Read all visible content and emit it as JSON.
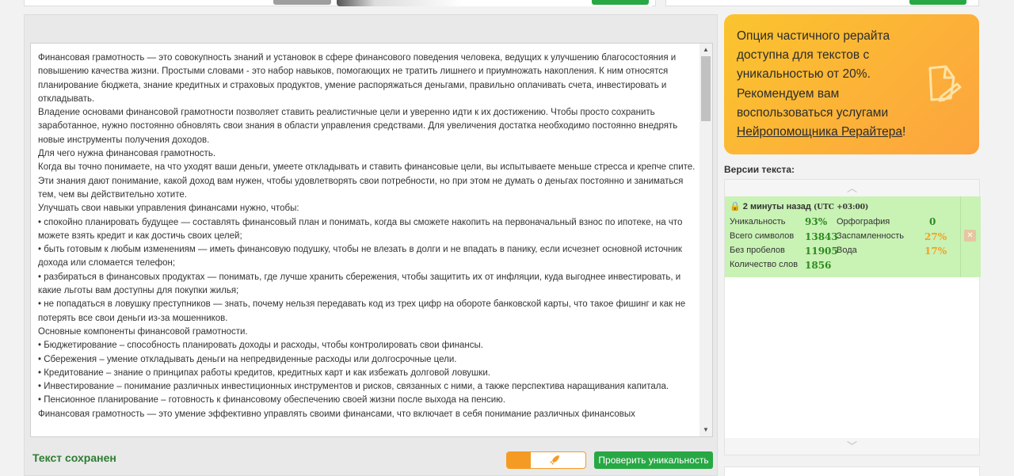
{
  "editor": {
    "paragraphs": [
      "Финансовая грамотность — это совокупность знаний и установок в сфере финансового поведения человека, ведущих к улучшению благосостояния и повышению качества жизни. Простыми словами - это набор навыков, помогающих не тратить лишнего и приумножать накопления. К ним относятся планирование бюджета, знание кредитных и страховых продуктов, умение распоряжаться деньгами, правильно оплачивать счета, инвестировать и откладывать.",
      "Владение основами финансовой грамотности позволяет ставить реалистичные цели и уверенно идти к их достижению. Чтобы просто сохранить заработанное, нужно постоянно обновлять свои знания в области управления средствами. Для увеличения достатка необходимо постоянно внедрять новые инструменты получения доходов.",
      "Для чего нужна финансовая грамотность.",
      "Когда вы точно понимаете, на что уходят ваши деньги, умеете откладывать и ставить финансовые цели, вы испытываете меньше стресса и крепче спите. Эти знания дают понимание, какой доход вам нужен, чтобы удовлетворять свои потребности, но при этом не думать о деньгах постоянно и заниматься тем, чем вы действительно хотите.",
      "Улучшать свои навыки управления финансами нужно, чтобы:",
      "• спокойно планировать будущее — составлять финансовый план и понимать, когда вы сможете накопить на первоначальный взнос по ипотеке, на что можете взять кредит и как достичь своих целей;",
      "• быть готовым к любым изменениям — иметь финансовую подушку, чтобы не влезать в долги и не впадать в панику, если исчезнет основной источник дохода или сломается телефон;",
      "• разбираться в финансовых продуктах — понимать, где лучше хранить сбережения, чтобы защитить их от инфляции, куда выгоднее инвестировать, и какие льготы вам доступны для покупки жилья;",
      "• не попадаться в ловушку преступников — знать, почему нельзя передавать код из трех цифр на обороте банковской карты, что такое фишинг и как не потерять все свои деньги из-за мошенников.",
      "Основные компоненты финансовой грамотности.",
      "• Бюджетирование – способность планировать доходы и расходы, чтобы контролировать свои финансы.",
      "• Сбережения – умение откладывать деньги на непредвиденные расходы или долгосрочные цели.",
      "• Кредитование – знание о принципах работы кредитов, кредитных карт и как избежать долговой ловушки.",
      "• Инвестирование – понимание различных инвестиционных инструментов и рисков, связанных с ними, а также перспектива наращивания капитала.",
      "• Пенсионное планирование – готовность к финансовому обеспечению своей жизни после выхода на пенсию.",
      "Финансовая грамотность — это умение эффективно управлять своими финансами, что включает в себя понимание различных финансовых"
    ],
    "saved_status": "Текст сохранен",
    "check_button": "Проверить уникальность",
    "toggle_icon": "rocket-icon"
  },
  "promo": {
    "text": "Опция частичного рерайта доступна для текстов с уникальностью от 20%. Рекомендуем вам воспользоваться услугами",
    "link": "Нейропомощника Рерайтера",
    "suffix": "!"
  },
  "versions": {
    "title": "Версии текста:",
    "items": [
      {
        "time": "2 минуты назад",
        "tz": "(UTC +03:00)",
        "uniqueness_label": "Уникальность",
        "uniqueness": "93%",
        "spelling_label": "Орфография",
        "spelling": "0",
        "chars_label": "Всего символов",
        "chars": "13843",
        "spam_label": "Заспамленность",
        "spam": "27%",
        "nospace_label": "Без пробелов",
        "nospace": "11905",
        "water_label": "Вода",
        "water": "17%",
        "words_label": "Количество слов",
        "words": "1856"
      }
    ]
  },
  "colors": {
    "green": "#27a844",
    "orange": "#f59a23",
    "version_bg": "#c9f2b5"
  }
}
